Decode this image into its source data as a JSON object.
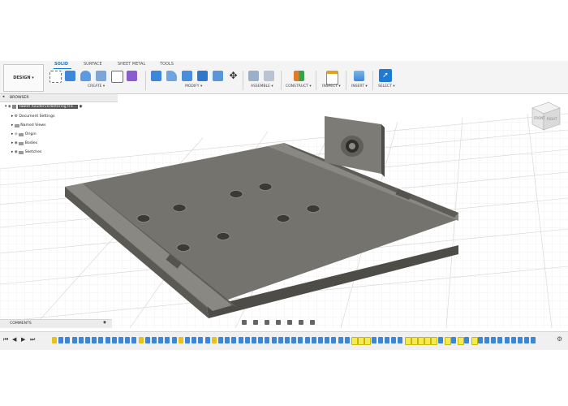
{
  "app": {
    "workspace_label": "DESIGN",
    "workspace_arrow": "▾"
  },
  "tabs": [
    "SOLID",
    "SURFACE",
    "SHEET METAL",
    "TOOLS"
  ],
  "groups": {
    "create": "CREATE ▾",
    "modify": "MODIFY ▾",
    "assemble": "ASSEMBLE ▾",
    "construct": "CONSTRUCT ▾",
    "inspect": "INSPECT ▾",
    "insert": "INSERT ▾",
    "select": "SELECT ▾"
  },
  "browser": {
    "title": "BROWSER",
    "document": "tablet houderverbetering tra...",
    "items": [
      "Document Settings",
      "Named Views",
      "Origin",
      "Bodies",
      "Sketches"
    ]
  },
  "comments": {
    "title": "COMMENTS"
  },
  "viewcube": {
    "face": "FRONT",
    "side": "RIGHT"
  },
  "colors": {
    "accent": "#0b78d7",
    "toolbar": "#f4f4f4",
    "body": "#727069",
    "grid": "#d9d9d9"
  },
  "timeline": {
    "markers": [
      "y",
      "b",
      "b",
      "b",
      "b",
      "b",
      "b",
      "b",
      "b",
      "b",
      "b",
      "b",
      "b",
      "y",
      "b",
      "b",
      "b",
      "b",
      "b",
      "y",
      "b",
      "b",
      "b",
      "b",
      "y",
      "b",
      "b",
      "b",
      "b",
      "b",
      "b",
      "b",
      "b",
      "b",
      "b",
      "b",
      "b",
      "b",
      "b",
      "b",
      "b",
      "b",
      "b",
      "b",
      "b",
      "Y",
      "Y",
      "Y",
      "b",
      "b",
      "b",
      "b",
      "b",
      "Y",
      "Y",
      "Y",
      "Y",
      "Y",
      "b",
      "Y",
      "b",
      "Y",
      "b",
      "Y",
      "b",
      "b",
      "b",
      "b",
      "b",
      "b",
      "b",
      "b",
      "b"
    ]
  }
}
